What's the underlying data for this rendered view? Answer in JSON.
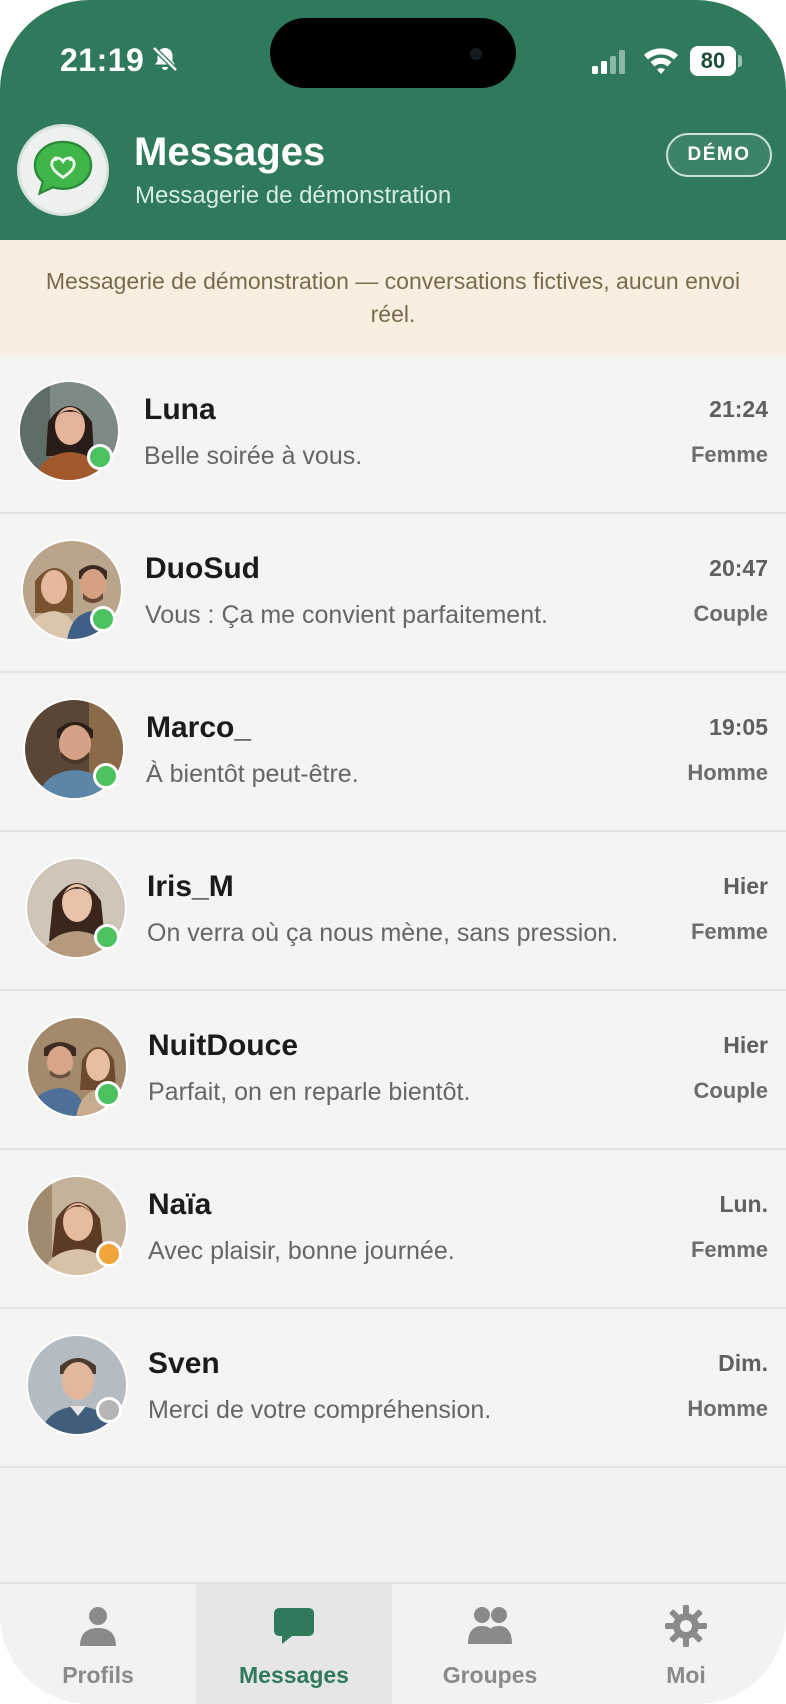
{
  "status_bar": {
    "time": "21:19",
    "battery": "80"
  },
  "header": {
    "title": "Messages",
    "subtitle": "Messagerie de démonstration",
    "badge": "DÉMO",
    "color": "#2f7a5b"
  },
  "banner": {
    "text": "Messagerie de démonstration — conversations fictives, aucun envoi réel."
  },
  "conversations": [
    {
      "name": "Luna",
      "preview": "Belle soirée à vous.",
      "time": "21:24",
      "type": "Femme",
      "status": "online"
    },
    {
      "name": "DuoSud",
      "preview": "Vous : Ça me convient parfaitement.",
      "time": "20:47",
      "type": "Couple",
      "status": "online"
    },
    {
      "name": "Marco_",
      "preview": "À bientôt peut-être.",
      "time": "19:05",
      "type": "Homme",
      "status": "online"
    },
    {
      "name": "Iris_M",
      "preview": "On verra où ça nous mène, sans pression.",
      "time": "Hier",
      "type": "Femme",
      "status": "online"
    },
    {
      "name": "NuitDouce",
      "preview": "Parfait, on en reparle bientôt.",
      "time": "Hier",
      "type": "Couple",
      "status": "online"
    },
    {
      "name": "Naïa",
      "preview": "Avec plaisir, bonne journée.",
      "time": "Lun.",
      "type": "Femme",
      "status": "away"
    },
    {
      "name": "Sven",
      "preview": "Merci de votre compréhension.",
      "time": "Dim.",
      "type": "Homme",
      "status": "offline"
    }
  ],
  "status_colors": {
    "online": "#4cc15f",
    "away": "#f0a63a",
    "offline": "#b5b5b5"
  },
  "nav": {
    "items": [
      {
        "label": "Profils",
        "icon": "person-icon"
      },
      {
        "label": "Messages",
        "icon": "chat-bubble-icon",
        "active": true
      },
      {
        "label": "Groupes",
        "icon": "group-icon"
      },
      {
        "label": "Moi",
        "icon": "gear-icon"
      }
    ]
  }
}
